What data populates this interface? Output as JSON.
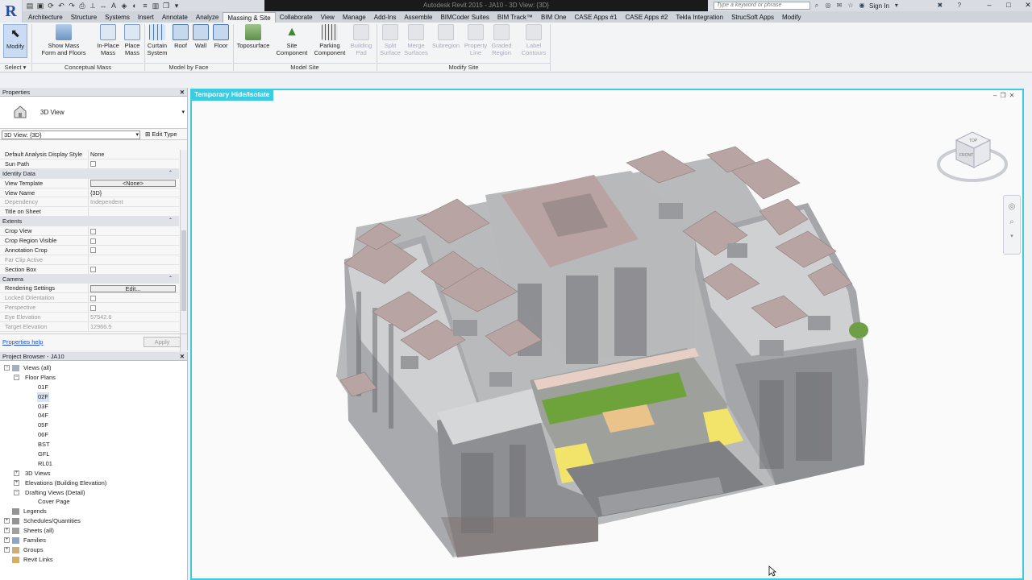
{
  "app": {
    "logo_letter": "R",
    "document_title": "Autodesk Revit 2015 - JA10 - 3D View: {3D}",
    "search_placeholder": "Type a keyword or phrase",
    "sign_in": "Sign In"
  },
  "tabs": [
    "Architecture",
    "Structure",
    "Systems",
    "Insert",
    "Annotate",
    "Analyze",
    "Massing & Site",
    "Collaborate",
    "View",
    "Manage",
    "Add-Ins",
    "Assemble",
    "BIMCoder Suites",
    "BIM Track™",
    "BIM One",
    "CASE Apps #1",
    "CASE Apps #2",
    "Tekla Integration",
    "StrucSoft Apps",
    "Modify"
  ],
  "active_tab": "Massing & Site",
  "ribbon": {
    "modify": "Modify",
    "select": "Select ▾",
    "show_mass": "Show Mass\nForm and Floors",
    "in_place_mass": "In-Place\nMass",
    "place_mass": "Place\nMass",
    "curtain_system": "Curtain\nSystem",
    "roof": "Roof",
    "wall": "Wall",
    "floor": "Floor",
    "toposurface": "Toposurface",
    "site_component": "Site\nComponent",
    "parking_component": "Parking\nComponent",
    "building_pad": "Building\nPad",
    "split_surface": "Split\nSurface",
    "merge_surfaces": "Merge\nSurfaces",
    "subregion": "Subregion",
    "property_line": "Property\nLine",
    "graded_region": "Graded\nRegion",
    "label_contours": "Label\nContours",
    "panels": [
      "Conceptual Mass",
      "Model by Face",
      "Model Site",
      "Modify Site"
    ]
  },
  "properties": {
    "title": "Properties",
    "type_name": "3D View",
    "instance_selector": "3D View: {3D}",
    "edit_type": "Edit Type",
    "rows": [
      {
        "kind": "row",
        "name": "Default Analysis Display Style",
        "value": "None"
      },
      {
        "kind": "check",
        "name": "Sun Path"
      },
      {
        "kind": "group",
        "name": "Identity Data"
      },
      {
        "kind": "button",
        "name": "View Template",
        "value": "<None>"
      },
      {
        "kind": "row",
        "name": "View Name",
        "value": "{3D}"
      },
      {
        "kind": "row",
        "name": "Dependency",
        "value": "Independent",
        "dim": true
      },
      {
        "kind": "row",
        "name": "Title on Sheet",
        "value": ""
      },
      {
        "kind": "group",
        "name": "Extents"
      },
      {
        "kind": "check",
        "name": "Crop View"
      },
      {
        "kind": "check",
        "name": "Crop Region Visible"
      },
      {
        "kind": "check",
        "name": "Annotation Crop"
      },
      {
        "kind": "row",
        "name": "Far Clip Active",
        "value": "",
        "dim": true
      },
      {
        "kind": "check",
        "name": "Section Box"
      },
      {
        "kind": "group",
        "name": "Camera"
      },
      {
        "kind": "button",
        "name": "Rendering Settings",
        "value": "Edit..."
      },
      {
        "kind": "check",
        "name": "Locked Orientation",
        "dim": true
      },
      {
        "kind": "check",
        "name": "Perspective",
        "dim": true
      },
      {
        "kind": "row",
        "name": "Eye Elevation",
        "value": "57542.6",
        "dim": true
      },
      {
        "kind": "row",
        "name": "Target Elevation",
        "value": "12966.5",
        "dim": true
      }
    ],
    "help": "Properties help",
    "apply": "Apply"
  },
  "browser": {
    "title": "Project Browser - JA10",
    "nodes": [
      {
        "label": "Views (all)",
        "level": 0,
        "toggle": "−",
        "icon": "views"
      },
      {
        "label": "Floor Plans",
        "level": 1,
        "toggle": "−"
      },
      {
        "label": "01F",
        "level": 3
      },
      {
        "label": "02F",
        "level": 3,
        "selected": true
      },
      {
        "label": "03F",
        "level": 3
      },
      {
        "label": "04F",
        "level": 3
      },
      {
        "label": "05F",
        "level": 3
      },
      {
        "label": "06F",
        "level": 3
      },
      {
        "label": "BST",
        "level": 3
      },
      {
        "label": "GFL",
        "level": 3
      },
      {
        "label": "RL01",
        "level": 3
      },
      {
        "label": "3D Views",
        "level": 1,
        "toggle": "+"
      },
      {
        "label": "Elevations (Building Elevation)",
        "level": 1,
        "toggle": "+"
      },
      {
        "label": "Drafting Views (Detail)",
        "level": 1,
        "toggle": "−"
      },
      {
        "label": "Cover Page",
        "level": 3
      },
      {
        "label": "Legends",
        "level": 0,
        "icon": "grid"
      },
      {
        "label": "Schedules/Quantities",
        "level": 0,
        "toggle": "+",
        "icon": "grid"
      },
      {
        "label": "Sheets (all)",
        "level": 0,
        "toggle": "+",
        "icon": "sheet"
      },
      {
        "label": "Families",
        "level": 0,
        "toggle": "+",
        "icon": "fam"
      },
      {
        "label": "Groups",
        "level": 0,
        "toggle": "+",
        "icon": "grp"
      },
      {
        "label": "Revit Links",
        "level": 0,
        "icon": "link"
      }
    ]
  },
  "view": {
    "temp_hide_label": "Temporary Hide/Isolate",
    "cube_top": "TOP",
    "cube_front": "FRONT"
  },
  "colors": {
    "accent_cyan": "#3ccbe0",
    "roof": "#b9a5a3",
    "building": "#c2c3c5",
    "grass": "#6ea23a",
    "yellow": "#f2e36a"
  }
}
